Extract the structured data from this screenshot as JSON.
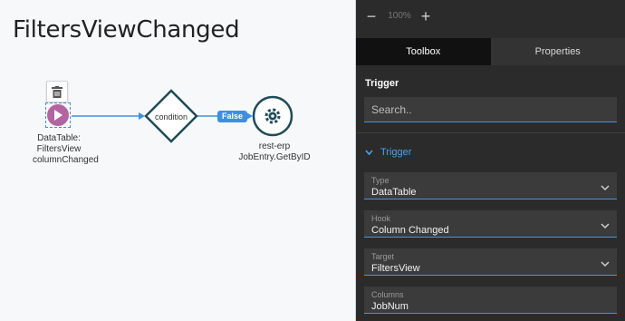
{
  "canvas": {
    "title": "FiltersViewChanged",
    "trigger_label": "DataTable: FiltersView columnChanged",
    "condition_label": "condition",
    "branch_label": "False",
    "action_label_line1": "rest-erp",
    "action_label_line2": "JobEntry.GetByID"
  },
  "zoom": {
    "out_symbol": "−",
    "level": "100%",
    "in_symbol": "+"
  },
  "tabs": [
    {
      "label": "Toolbox",
      "active": true
    },
    {
      "label": "Properties",
      "active": false
    }
  ],
  "panel": {
    "heading": "Trigger",
    "search_placeholder": "Search..",
    "group_title": "Trigger",
    "fields": {
      "type": {
        "label": "Type",
        "value": "DataTable"
      },
      "hook": {
        "label": "Hook",
        "value": "Column Changed"
      },
      "target": {
        "label": "Target",
        "value": "FiltersView"
      },
      "columns": {
        "label": "Columns",
        "value": "JobNum"
      }
    }
  },
  "colors": {
    "accent": "#4da3ec",
    "trigger_node": "#b265a0",
    "node_stroke": "#1f4b57",
    "connector": "#3d8fe0"
  },
  "icons": {
    "delete": "trash-icon",
    "trigger": "play-icon",
    "action": "gear-icon",
    "dropdown": "chevron-down-icon"
  }
}
